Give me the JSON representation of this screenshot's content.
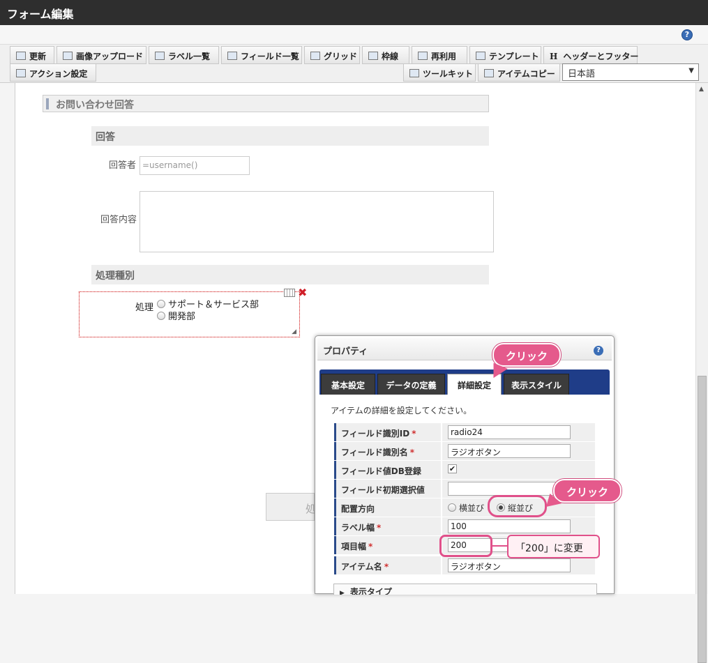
{
  "window": {
    "title": "フォーム編集"
  },
  "toolbar": {
    "row1": [
      "更新",
      "画像アップロード",
      "ラベル一覧",
      "フィールド一覧",
      "グリッド",
      "枠線",
      "再利用",
      "テンプレート",
      "ヘッダーとフッター"
    ],
    "row2_left": "アクション設定",
    "row2_right": [
      "ツールキット",
      "アイテムコピー"
    ],
    "language": "日本語",
    "header_icon_glyph": "H"
  },
  "form": {
    "section_title": "お問い合わせ回答",
    "sub_answer": "回答",
    "responder_label": "回答者",
    "responder_value": "=username()",
    "content_label": "回答内容",
    "sub_type": "処理種別",
    "radio_label": "処理",
    "radio_options": [
      "サポート＆サービス部",
      "開発部"
    ],
    "hidden_button_text": "処"
  },
  "properties": {
    "title": "プロパティ",
    "tabs": [
      "基本設定",
      "データの定義",
      "詳細設定",
      "表示スタイル"
    ],
    "active_tab": "詳細設定",
    "description": "アイテムの詳細を設定してください。",
    "rows": {
      "field_id": {
        "label": "フィールド識別ID",
        "value": "radio24",
        "required": "*"
      },
      "field_name": {
        "label": "フィールド識別名",
        "value": "ラジオボタン",
        "required": "*"
      },
      "db_register": {
        "label": "フィールド値DB登録",
        "checked": "✔"
      },
      "initial_value": {
        "label": "フィールド初期選択値",
        "value": ""
      },
      "orientation": {
        "label": "配置方向",
        "opt_horizontal": "横並び",
        "opt_vertical": "縦並び",
        "selected": "縦並び"
      },
      "label_width": {
        "label": "ラベル幅",
        "value": "100",
        "required": "*"
      },
      "item_width": {
        "label": "項目幅",
        "value": "200",
        "required": "*"
      },
      "item_name": {
        "label": "アイテム名",
        "value": "ラジオボタン",
        "required": "*"
      }
    },
    "collapsed_section": "表示タイプ"
  },
  "annotations": {
    "callout_tab": "クリック",
    "callout_radio": "クリック",
    "note_width": "「200」に変更"
  },
  "colors": {
    "accent_pink": "#e55a8c",
    "tab_bar_blue": "#1f3d88",
    "title_bar": "#2e2e2e"
  }
}
